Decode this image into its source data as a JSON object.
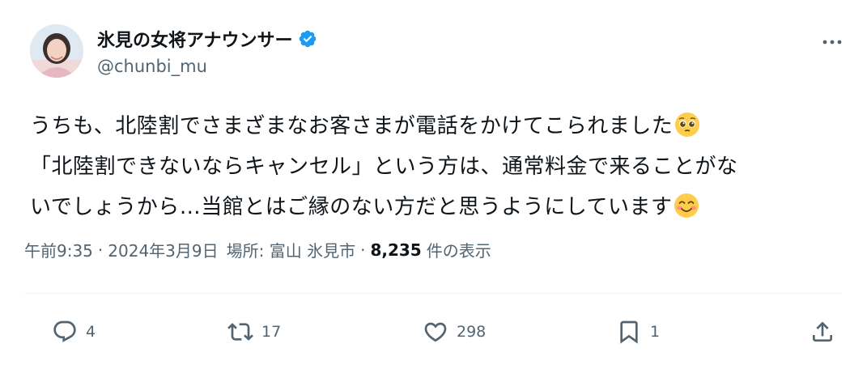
{
  "author": {
    "display_name": "氷見の女将アナウンサー",
    "handle": "@chunbi_mu"
  },
  "tweet": {
    "line1": "うちも、北陸割でさまざまなお客さまが電話をかけてこられました",
    "line2": "「北陸割できないならキャンセル」という方は、通常料金で来ることがな",
    "line3": "いでしょうから…当館とはご縁のない方だと思うようにしています",
    "emoji1": "pleading-face",
    "emoji2": "smiling-face"
  },
  "meta": {
    "time": "午前9:35",
    "separator": "·",
    "date": "2024年3月9日",
    "location": "場所: 富山 氷見市",
    "views_count": "8,235",
    "views_label": "件の表示"
  },
  "actions": {
    "replies": "4",
    "retweets": "17",
    "likes": "298",
    "bookmarks": "1"
  },
  "colors": {
    "verified_blue": "#1d9bf0",
    "text_primary": "#0f1419",
    "text_secondary": "#536471"
  }
}
